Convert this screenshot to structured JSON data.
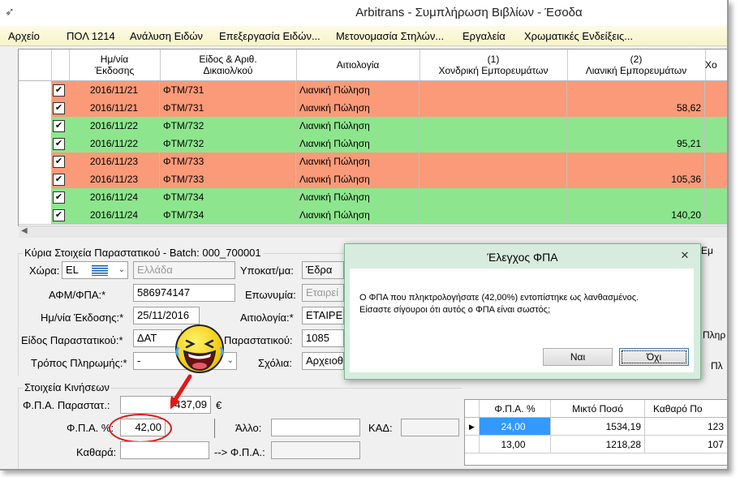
{
  "window": {
    "title": "Arbitrans - Συμπλήρωση Βιβλίων - Έσοδα"
  },
  "menu": [
    "Αρχείο",
    "ΠΟΛ 1214",
    "Ανάλυση Ειδών",
    "Επεξεργασία Ειδών...",
    "Μετονομασία Στηλών...",
    "Εργαλεία",
    "Χρωματικές Ενδείξεις..."
  ],
  "grid": {
    "columns": [
      "Ημ/νία\nΈκδοσης",
      "Είδος & Αριθ.\nΔικαιολ/κού",
      "Αιτιολογία",
      "(1)\nΧονδρική Εμπορευμάτων",
      "(2)\nΛιανική Εμπορευμάτων",
      "Χο"
    ],
    "rows": [
      {
        "checked": "✔",
        "date": "2016/11/21",
        "doc": "ΦΤΜ/731",
        "reason": "Λιανική Πώληση",
        "wholesale": "",
        "retail": "",
        "color": "o"
      },
      {
        "checked": "✔",
        "date": "2016/11/21",
        "doc": "ΦΤΜ/731",
        "reason": "Λιανική Πώληση",
        "wholesale": "",
        "retail": "58,62",
        "color": "o"
      },
      {
        "checked": "✔",
        "date": "2016/11/22",
        "doc": "ΦΤΜ/732",
        "reason": "Λιανική Πώληση",
        "wholesale": "",
        "retail": "",
        "color": "g"
      },
      {
        "checked": "✔",
        "date": "2016/11/22",
        "doc": "ΦΤΜ/732",
        "reason": "Λιανική Πώληση",
        "wholesale": "",
        "retail": "95,21",
        "color": "g"
      },
      {
        "checked": "✔",
        "date": "2016/11/23",
        "doc": "ΦΤΜ/733",
        "reason": "Λιανική Πώληση",
        "wholesale": "",
        "retail": "",
        "color": "o"
      },
      {
        "checked": "✔",
        "date": "2016/11/23",
        "doc": "ΦΤΜ/733",
        "reason": "Λιανική Πώληση",
        "wholesale": "",
        "retail": "105,36",
        "color": "o"
      },
      {
        "checked": "✔",
        "date": "2016/11/24",
        "doc": "ΦΤΜ/734",
        "reason": "Λιανική Πώληση",
        "wholesale": "",
        "retail": "",
        "color": "g"
      },
      {
        "checked": "✔",
        "date": "2016/11/24",
        "doc": "ΦΤΜ/734",
        "reason": "Λιανική Πώληση",
        "wholesale": "",
        "retail": "140,20",
        "color": "g"
      }
    ]
  },
  "main": {
    "group_title": "Κύρια Στοιχεία Παραστατικού - Batch: 000_700001",
    "country_label": "Χώρα:",
    "country_code": "EL",
    "country_name": "Ελλάδα",
    "branch_label": "Υποκατ/μα:",
    "branch_value": "Έδρα",
    "afm_label": "ΑΦΜ/ΦΠΑ:*",
    "afm_value": "586974147",
    "name_label": "Επωνυμία:",
    "name_value": "Εταιρεί",
    "date_label": "Ημ/νία Έκδοσης:*",
    "date_value": "25/11/2016",
    "reason_label": "Αιτιολογία:*",
    "reason_value": "ΕΤΑΙΡΕ",
    "doctype_label": "Είδος Παραστατικού:*",
    "doctype_value": "ΔΑΤ",
    "docnum_label": "Παραστατικού:",
    "docnum_value": "1085",
    "payment_label": "Τρόπος Πληρωμής:*",
    "payment_value": "-",
    "comments_label": "Σχόλια:",
    "comments_value": "Αρχειοθ"
  },
  "right_margin": {
    "em": "Εμ",
    "pliri": "Πληρ",
    "pl": "Πλ"
  },
  "movements": {
    "group_title": "Στοιχεία Κινήσεων",
    "vat_doc_label": "Φ.Π.Α. Παραστατ.:",
    "vat_doc_value": "437,09",
    "currency": "€",
    "vat_pct_label": "Φ.Π.Α. %:",
    "vat_pct_value": "42,00",
    "other_label": "Άλλο:",
    "kad_label": "ΚΑΔ:",
    "net_label": "Καθαρά:",
    "arrow_vat_label": "--> Φ.Π.Α.:"
  },
  "vat_grid": {
    "columns": [
      "Φ.Π.Α. %",
      "Μικτό Ποσό",
      "Καθαρό Πο"
    ],
    "rows": [
      {
        "pct": "24,00",
        "gross": "1534,19",
        "net": "123"
      },
      {
        "pct": "13,00",
        "gross": "1218,28",
        "net": "107"
      }
    ]
  },
  "dialog": {
    "title": "Έλεγχος ΦΠΑ",
    "close": "✕",
    "line1": "Ο ΦΠΑ που πληκτρολογήσατε (42,00%) εντοπίστηκε ως λανθασμένος.",
    "line2": "Είσαστε σίγουροι ότι αυτός ο ΦΠΑ είναι σωστός;",
    "yes": "Ναι",
    "no": "Όχι"
  },
  "colors": {
    "orange_row": "#fa9a78",
    "green_row": "#8de68d",
    "highlight_circle": "#e01818",
    "selected_cell": "#3399ff"
  }
}
